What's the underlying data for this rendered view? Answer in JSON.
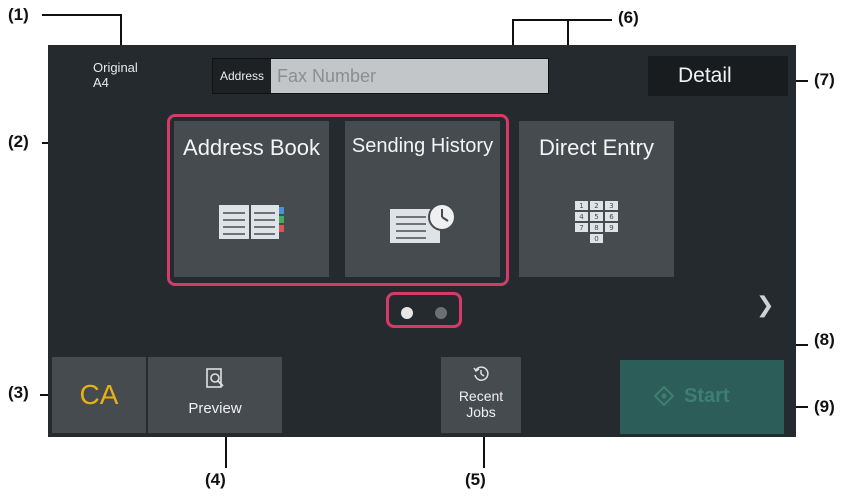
{
  "callouts": [
    "(1)",
    "(2)",
    "(3)",
    "(4)",
    "(5)",
    "(6)",
    "(7)",
    "(8)",
    "(9)"
  ],
  "header": {
    "original_label": "Original",
    "original_size": "A4",
    "address_label": "Address",
    "address_placeholder": "Fax Number",
    "detail_label": "Detail"
  },
  "tiles": [
    {
      "label": "Address Book",
      "icon": "address-book-icon"
    },
    {
      "label": "Sending History",
      "icon": "sending-history-icon"
    },
    {
      "label": "Direct Entry",
      "icon": "keypad-icon"
    }
  ],
  "keypad": [
    "1",
    "2",
    "3",
    "4",
    "5",
    "6",
    "7",
    "8",
    "9",
    "0"
  ],
  "pagination": {
    "pages": 2,
    "current": 1
  },
  "bottom": {
    "ca_label": "CA",
    "preview_label": "Preview",
    "recent_line1": "Recent",
    "recent_line2": "Jobs",
    "start_label": "Start"
  },
  "colors": {
    "screen_bg": "#252a2e",
    "tile_bg": "#464b50",
    "highlight": "#d23c66",
    "ca_text": "#e8b20e",
    "start_bg": "#2d5d58"
  }
}
